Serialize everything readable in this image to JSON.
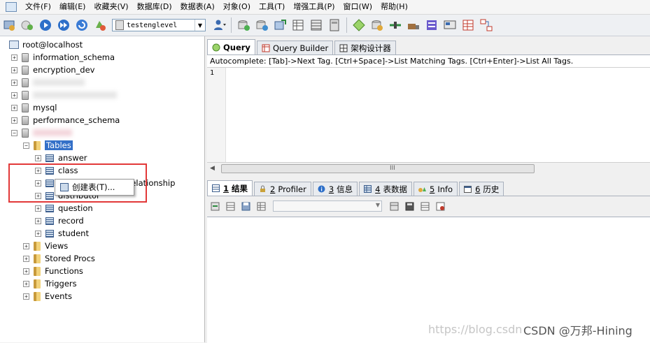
{
  "menu": [
    "文件(F)",
    "编辑(E)",
    "收藏夹(V)",
    "数据库(D)",
    "数据表(A)",
    "对象(O)",
    "工具(T)",
    "增强工具(P)",
    "窗口(W)",
    "帮助(H)"
  ],
  "toolbar": {
    "database_select": "testenglevel"
  },
  "tree": {
    "root": "root@localhost",
    "databases": [
      "information_schema",
      "encryption_dev",
      "mysql",
      "performance_schema"
    ],
    "tables_folder": "Tables",
    "tables": [
      "answer",
      "class",
      "class_distributor_relationship",
      "distributor",
      "question",
      "record",
      "student"
    ],
    "folders": [
      "Views",
      "Stored Procs",
      "Functions",
      "Triggers",
      "Events"
    ]
  },
  "context_menu": {
    "create_table": "创建表(T)..."
  },
  "query_tabs": [
    "Query",
    "Query Builder",
    "架构设计器"
  ],
  "autocomplete_hint": "Autocomplete: [Tab]->Next Tag. [Ctrl+Space]->List Matching Tags. [Ctrl+Enter]->List All Tags.",
  "editor": {
    "line_number": "1"
  },
  "scrollbar": {
    "grip": "III"
  },
  "result_tabs": [
    {
      "num": "1",
      "label": "结果"
    },
    {
      "num": "2",
      "label": "Profiler"
    },
    {
      "num": "3",
      "label": "信息"
    },
    {
      "num": "4",
      "label": "表数据"
    },
    {
      "num": "5",
      "label": "Info"
    },
    {
      "num": "6",
      "label": "历史"
    }
  ],
  "watermark": {
    "url": "https://blog.csdn",
    "brand": "CSDN @万邦-Hining"
  }
}
